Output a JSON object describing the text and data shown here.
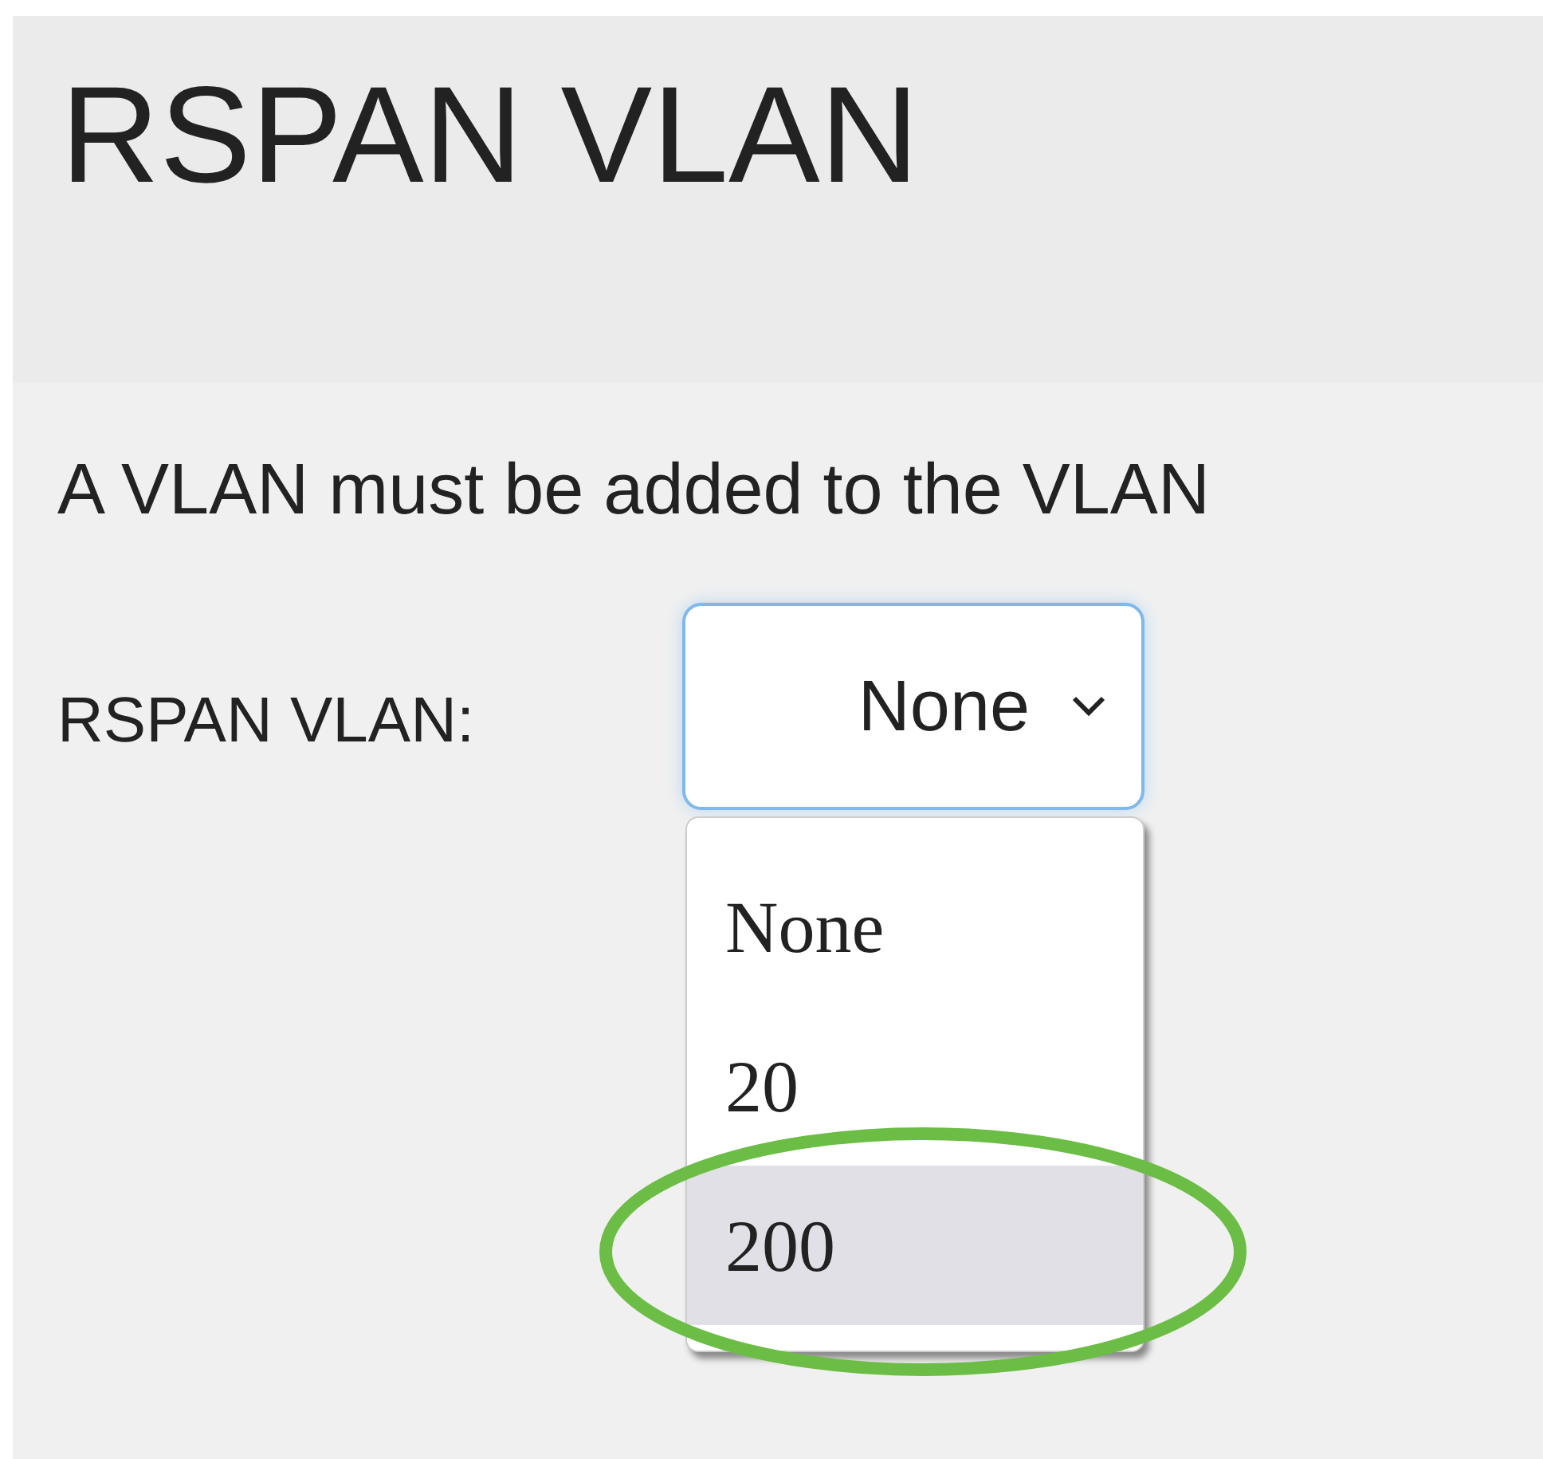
{
  "header": {
    "title": "RSPAN VLAN"
  },
  "description": "A VLAN must be added to the VLAN",
  "field": {
    "label": "RSPAN VLAN:",
    "value": "None",
    "expanded": true,
    "options": [
      {
        "label": "None",
        "highlighted": false
      },
      {
        "label": "20",
        "highlighted": false
      },
      {
        "label": "200",
        "highlighted": true
      }
    ]
  }
}
